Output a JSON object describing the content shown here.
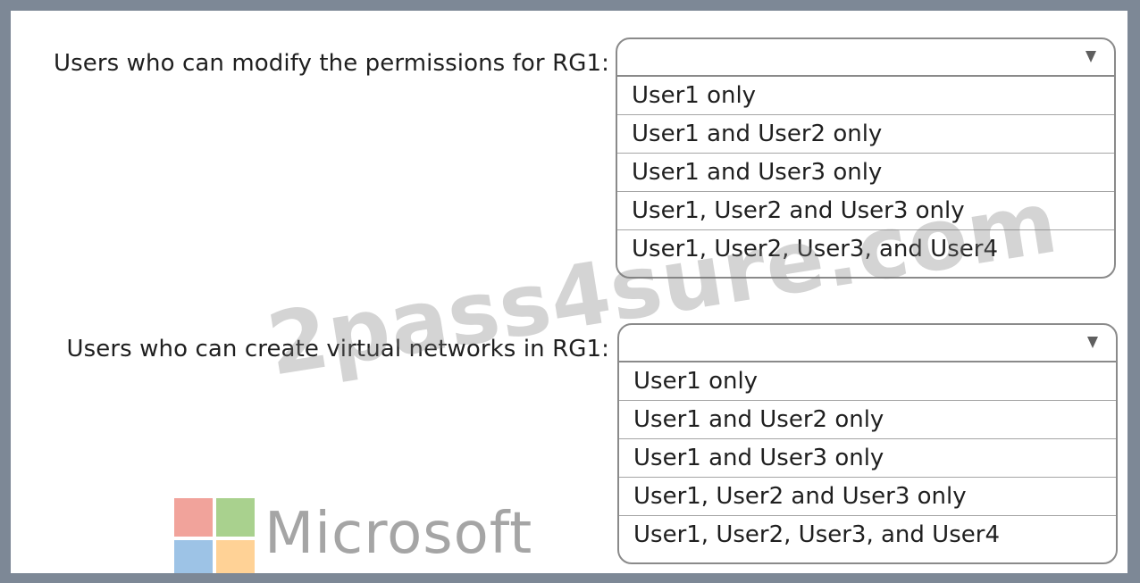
{
  "questions": [
    {
      "label": "Users who can modify the permissions for RG1:",
      "selected": "",
      "options": [
        "User1 only",
        "User1 and User2 only",
        "User1 and User3 only",
        "User1, User2 and User3 only",
        "User1, User2, User3, and User4"
      ]
    },
    {
      "label": "Users who can create virtual networks in RG1:",
      "selected": "",
      "options": [
        "User1 only",
        "User1 and User2 only",
        "User1 and User3 only",
        "User1, User2 and User3 only",
        "User1, User2, User3, and User4"
      ]
    }
  ],
  "watermark": "2pass4sure.com",
  "brand": {
    "wordmark": "Microsoft",
    "colors": [
      "#f1a39b",
      "#a9d18e",
      "#9dc3e6",
      "#ffd296"
    ]
  },
  "icons": {
    "dropdown_arrow": "triangle-down-icon"
  }
}
